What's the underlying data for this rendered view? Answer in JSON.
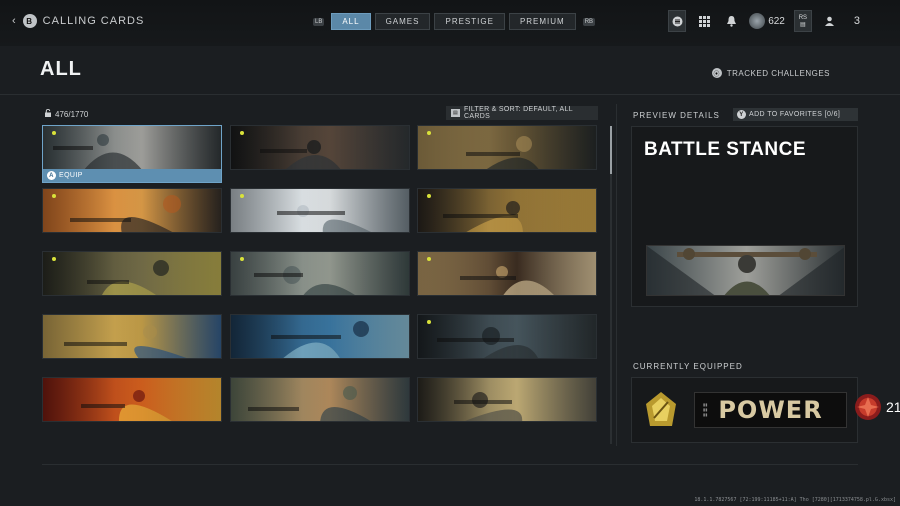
{
  "topbar": {
    "back_button_glyph": "B",
    "title": "CALLING CARDS",
    "left_bumper": "LB",
    "right_bumper": "RB",
    "tabs": [
      {
        "label": "ALL",
        "active": true
      },
      {
        "label": "GAMES",
        "active": false
      },
      {
        "label": "PRESTIGE",
        "active": false
      },
      {
        "label": "PREMIUM",
        "active": false
      }
    ],
    "currency_value": "622",
    "rs_label": "RS",
    "level": "3"
  },
  "header": {
    "title": "ALL",
    "tracked_challenges": "TRACKED CHALLENGES"
  },
  "grid": {
    "count": "476/1770",
    "filter_label": "FILTER & SORT: DEFAULT, ALL CARDS",
    "equip_button_glyph": "A",
    "equip_label": "EQUIP",
    "cards": [
      {
        "name": "battle-stance",
        "palette": [
          "#3f4a4e",
          "#a7a7a3",
          "#2d3336"
        ],
        "selected": true,
        "new": true
      },
      {
        "name": "card-2",
        "palette": [
          "#1a1c1d",
          "#5b4a3d",
          "#2f3539"
        ],
        "new": true
      },
      {
        "name": "card-3",
        "palette": [
          "#a48a55",
          "#6b5a38",
          "#24292a"
        ],
        "new": true
      },
      {
        "name": "card-4",
        "palette": [
          "#c46a2a",
          "#e2a04a",
          "#2f2a27"
        ],
        "new": true
      },
      {
        "name": "card-5",
        "palette": [
          "#b9c2c8",
          "#e4e8ea",
          "#6e7a82"
        ],
        "new": true
      },
      {
        "name": "card-6",
        "palette": [
          "#2a2520",
          "#9a7a3a",
          "#c9a048"
        ],
        "new": true
      },
      {
        "name": "card-7",
        "palette": [
          "#2b2d25",
          "#77704a",
          "#b5a84e"
        ],
        "new": true
      },
      {
        "name": "card-8",
        "palette": [
          "#586464",
          "#9aa096",
          "#3c4a4a"
        ],
        "new": true
      },
      {
        "name": "card-9",
        "palette": [
          "#b99a66",
          "#3d2e22",
          "#d8c39a"
        ],
        "new": true
      },
      {
        "name": "card-10",
        "palette": [
          "#b89a52",
          "#c7a14a",
          "#2f5a8a"
        ],
        "new": false
      },
      {
        "name": "card-11",
        "palette": [
          "#1d3a55",
          "#3c7aa6",
          "#88b8cc"
        ],
        "new": false
      },
      {
        "name": "card-12",
        "palette": [
          "#1e2428",
          "#4a5a62",
          "#2c3336"
        ],
        "new": true
      },
      {
        "name": "card-13",
        "palette": [
          "#7a1c12",
          "#d9631f",
          "#f0b33b"
        ],
        "new": false
      },
      {
        "name": "card-14",
        "palette": [
          "#5e6a58",
          "#b89060",
          "#3a4a50"
        ],
        "new": false
      },
      {
        "name": "card-15",
        "palette": [
          "#2c2a24",
          "#c8b37a",
          "#56544a"
        ],
        "new": false
      }
    ]
  },
  "preview": {
    "label": "PREVIEW DETAILS",
    "favorites_button_glyph": "Y",
    "favorites_label": "ADD TO FAVORITES [0/6]",
    "card_title": "BATTLE STANCE"
  },
  "equipped": {
    "label": "CURRENTLY EQUIPPED",
    "card_text": "POWER",
    "prestige_level": "21"
  },
  "footer": {
    "build_text": "18.1.1.7827567 [72:199:11185+11:A] Tho [7280][1713374758.pl.G.xbsx]"
  }
}
